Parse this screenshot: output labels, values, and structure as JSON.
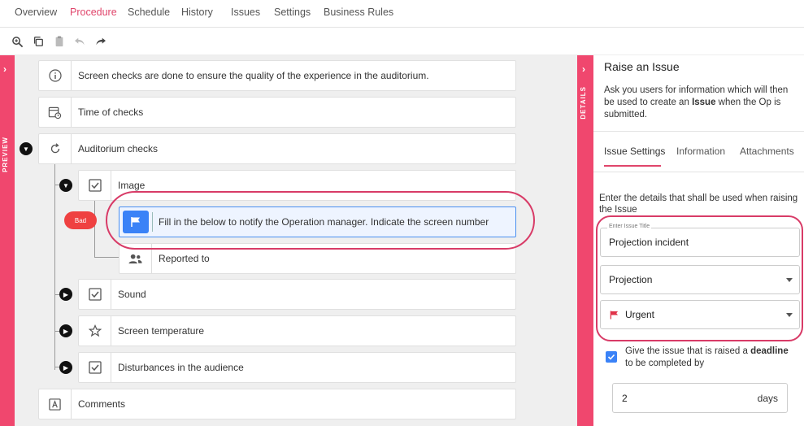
{
  "tabs": [
    {
      "label": "Overview",
      "active": false
    },
    {
      "label": "Procedure",
      "active": true
    },
    {
      "label": "Schedule",
      "active": false
    },
    {
      "label": "History",
      "active": false
    },
    {
      "label": "Issues",
      "active": false
    },
    {
      "label": "Settings",
      "active": false
    },
    {
      "label": "Business Rules",
      "active": false
    }
  ],
  "toolbar": {
    "icons": [
      "zoom-icon",
      "copy-icon",
      "paste-icon",
      "undo-icon",
      "redo-icon"
    ]
  },
  "preview": {
    "label": "PREVIEW"
  },
  "details": {
    "label": "DETAILS"
  },
  "procedure": {
    "intro": "Screen checks are done to ensure the quality of the experience in the auditorium.",
    "time_of_checks": "Time of checks",
    "auditorium_checks": "Auditorium checks",
    "image": "Image",
    "bad_pill": "Bad",
    "issue_step": "Fill in the below to notify the Operation manager. Indicate the screen number",
    "reported_to": "Reported to",
    "sound": "Sound",
    "screen_temperature": "Screen temperature",
    "disturbances": "Disturbances in the audience",
    "comments": "Comments"
  },
  "panel": {
    "title": "Raise an Issue",
    "desc_pre": "Ask you users for information which will then be used to create an ",
    "desc_bold": "Issue",
    "desc_post": " when the Op is submitted.",
    "tabs": [
      "Issue Settings",
      "Information",
      "Attachments"
    ],
    "intro": "Enter the details that shall be used when raising the Issue",
    "title_field_label": "Enter Issue Title",
    "title_field_value": "Projection incident",
    "category_value": "Projection",
    "priority_value": "Urgent",
    "deadline_pre": "Give the issue that is raised a ",
    "deadline_bold": "deadline",
    "deadline_post": " to be completed by",
    "deadline_value": "2",
    "deadline_unit": "days"
  },
  "colors": {
    "accent": "#e0456b",
    "strip": "#f0476e",
    "selected_blue": "#3a82f7",
    "bad_red": "#ef4141",
    "urgent_flag": "#e0344a"
  }
}
